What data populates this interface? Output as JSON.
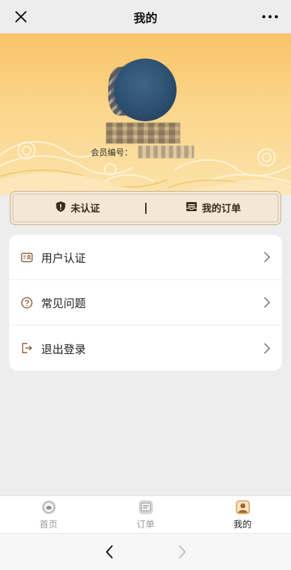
{
  "header": {
    "title": "我的",
    "close_icon": "close-icon",
    "more_icon": "more-icon"
  },
  "profile": {
    "member_label": "会员编号："
  },
  "status_bar": {
    "verify_label": "未认证",
    "orders_label": "我的订单",
    "verify_icon": "shield-alert-icon",
    "orders_icon": "orders-icon"
  },
  "menu": {
    "items": [
      {
        "label": "用户认证",
        "icon": "id-card-icon"
      },
      {
        "label": "常见问题",
        "icon": "question-icon"
      },
      {
        "label": "退出登录",
        "icon": "logout-icon"
      }
    ]
  },
  "tabbar": {
    "tabs": [
      {
        "label": "首页",
        "icon": "home-icon",
        "active": false
      },
      {
        "label": "订单",
        "icon": "order-tab-icon",
        "active": false
      },
      {
        "label": "我的",
        "icon": "profile-icon",
        "active": true
      }
    ]
  },
  "browser": {
    "back_icon": "back-icon",
    "forward_icon": "forward-icon"
  },
  "colors": {
    "accent": "#c8ad86",
    "hero_top": "#f8c468",
    "hero_bottom": "#fbe3ab",
    "status_bg": "#f3e7d6",
    "icon_brown": "#8a5a32"
  }
}
